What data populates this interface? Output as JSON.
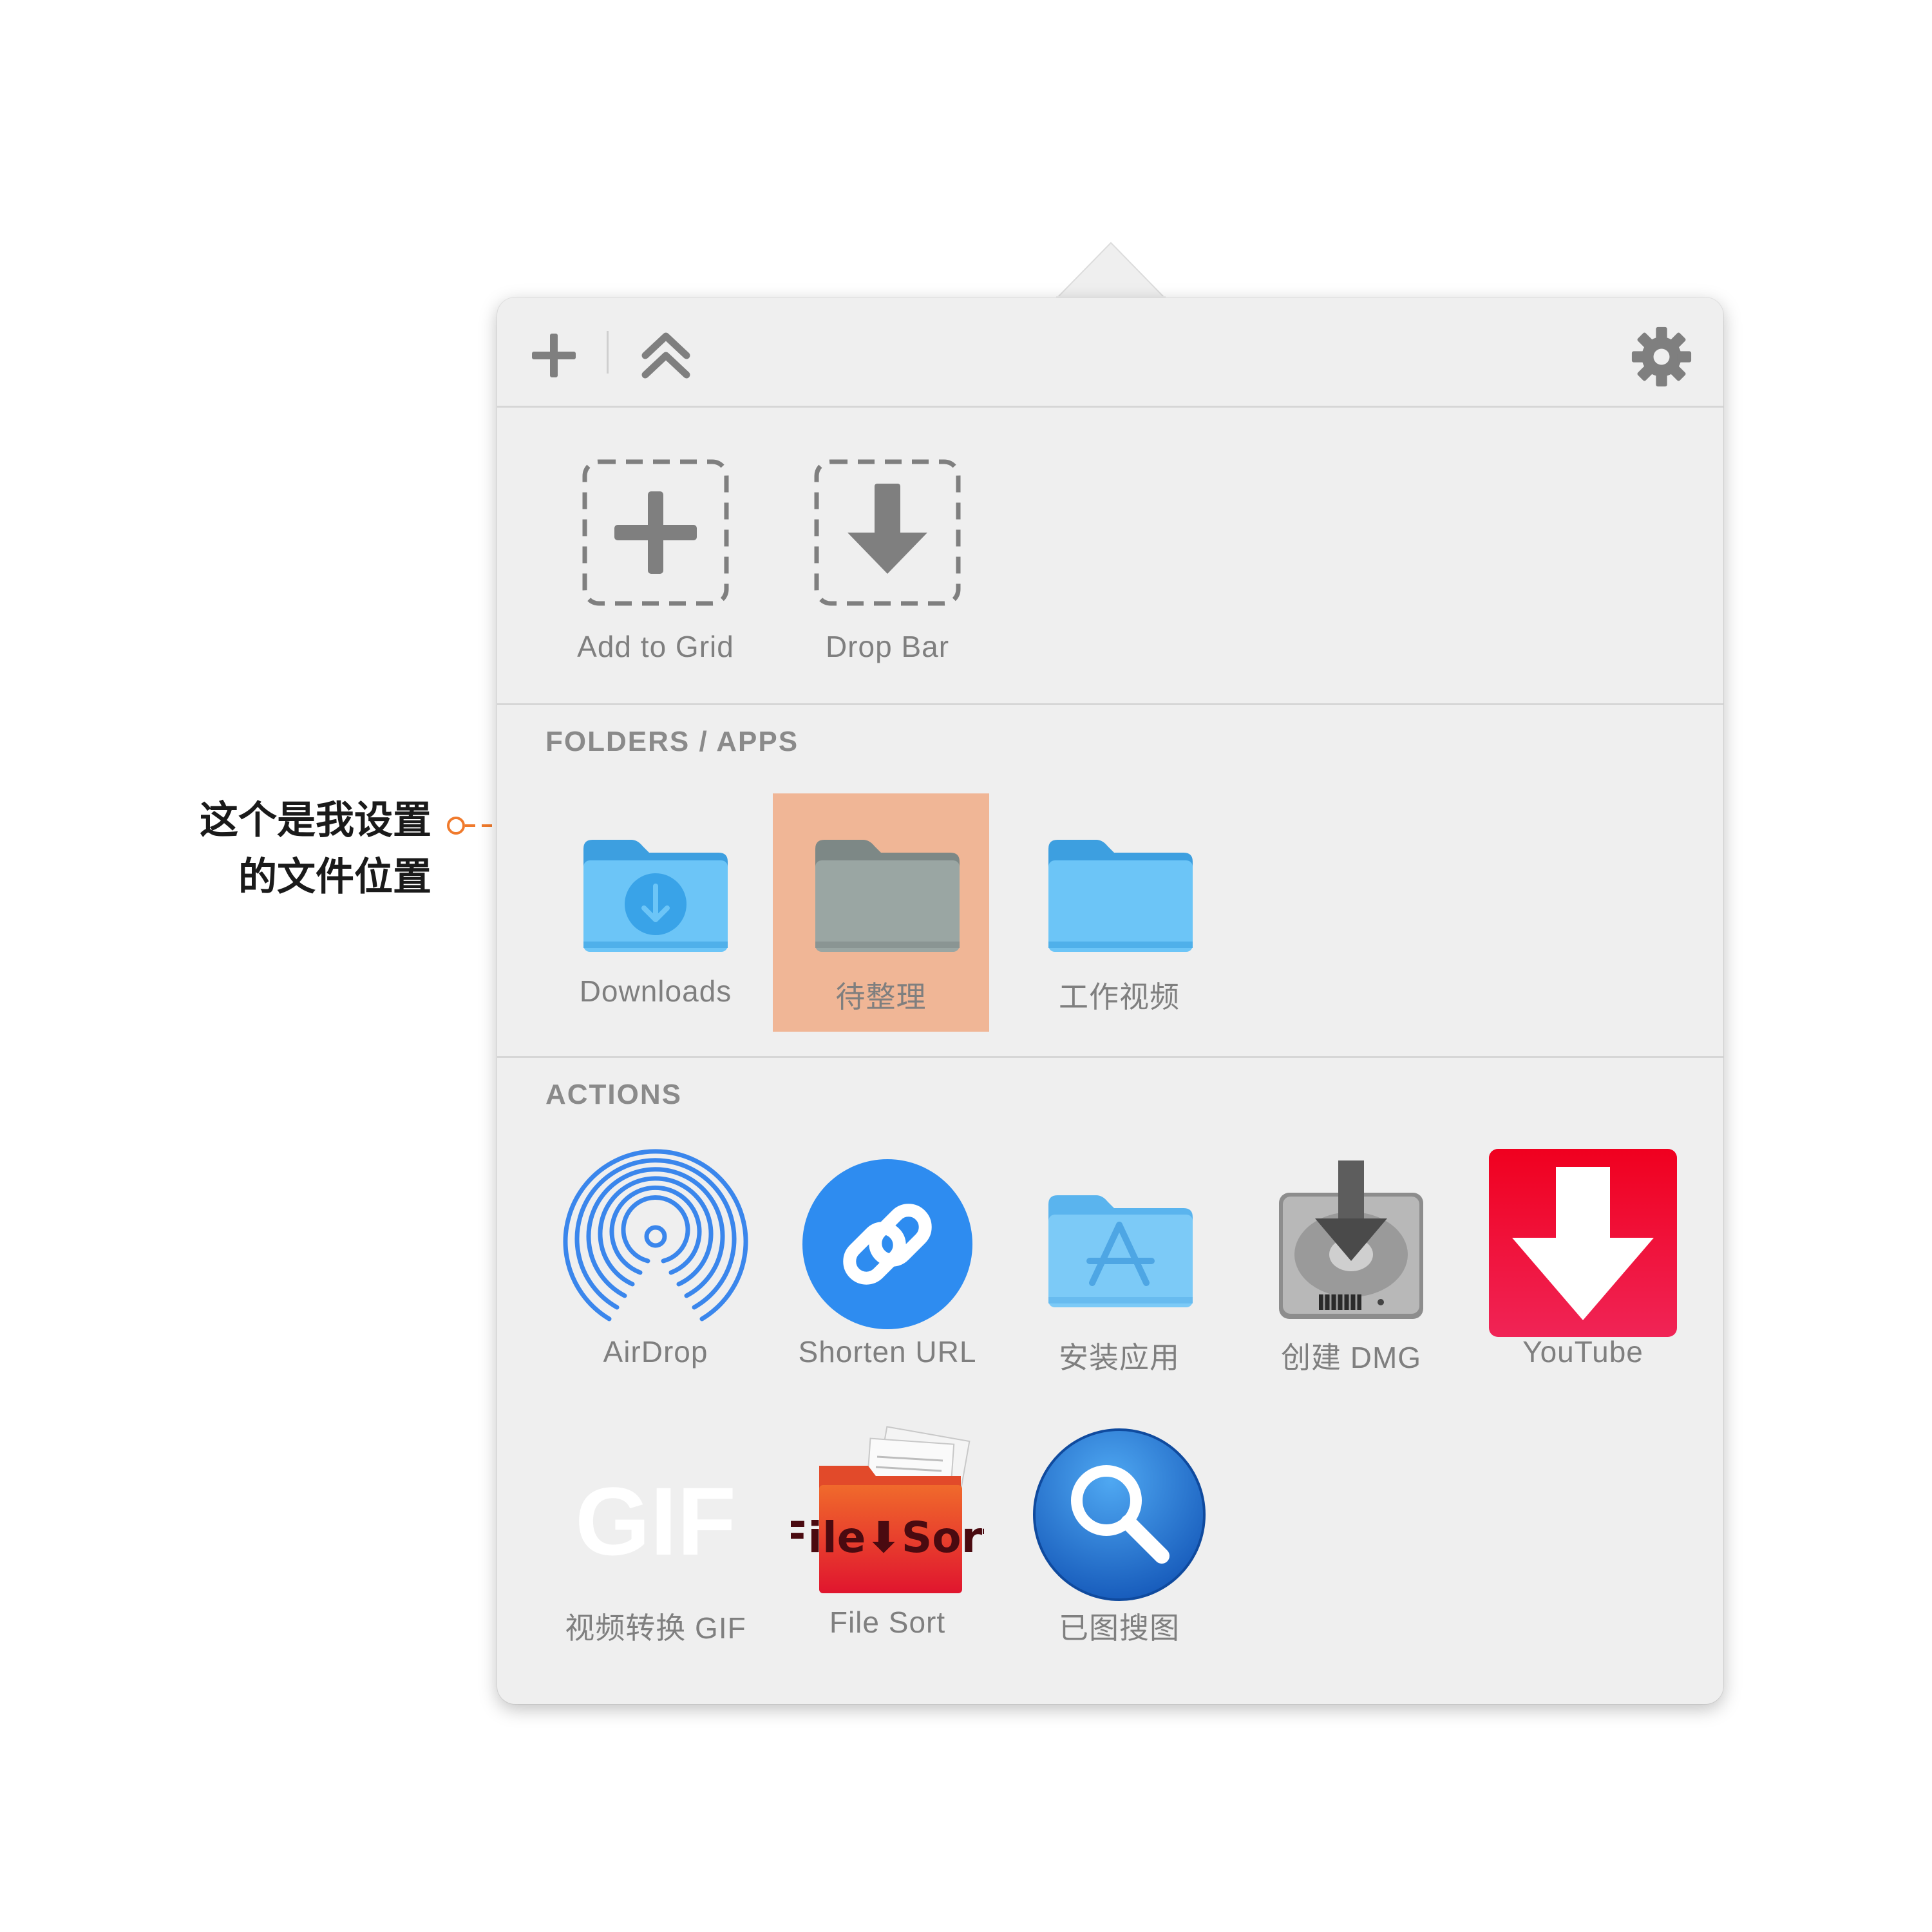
{
  "annotation": {
    "line1": "这个是我设置",
    "line2": "的文件位置"
  },
  "toolbar": {
    "add_icon": "plus-icon",
    "collapse_icon": "double-chevron-up-icon",
    "settings_icon": "gear-icon"
  },
  "quick": [
    {
      "label": "Add to Grid",
      "icon": "dashed-plus-icon"
    },
    {
      "label": "Drop Bar",
      "icon": "dashed-download-icon"
    }
  ],
  "folders": {
    "title": "FOLDERS / APPS",
    "items": [
      {
        "label": "Downloads",
        "icon": "downloads-folder-icon"
      },
      {
        "label": "待整理",
        "icon": "folder-icon",
        "selected": true
      },
      {
        "label": "工作视频",
        "icon": "folder-icon"
      }
    ]
  },
  "actions": {
    "title": "ACTIONS",
    "items": [
      {
        "label": "AirDrop",
        "icon": "airdrop-icon"
      },
      {
        "label": "Shorten URL",
        "icon": "link-icon"
      },
      {
        "label": "安装应用",
        "icon": "applications-folder-icon"
      },
      {
        "label": "创建 DMG",
        "icon": "disk-image-icon"
      },
      {
        "label": "YouTube",
        "icon": "youtube-download-icon"
      },
      {
        "label": "视频转换 GIF",
        "icon": "gif-icon",
        "icon_text": "GIF"
      },
      {
        "label": "File Sort",
        "icon": "file-sort-icon",
        "icon_text": "File⬇Sort"
      },
      {
        "label": "已图搜图",
        "icon": "magnifier-icon"
      }
    ]
  },
  "colors": {
    "panel_bg": "#efefef",
    "highlight": "#f0a880",
    "folder_blue": "#6cc5f7",
    "folder_gray": "#9aa6a3",
    "leader_orange": "#f07a2c"
  }
}
